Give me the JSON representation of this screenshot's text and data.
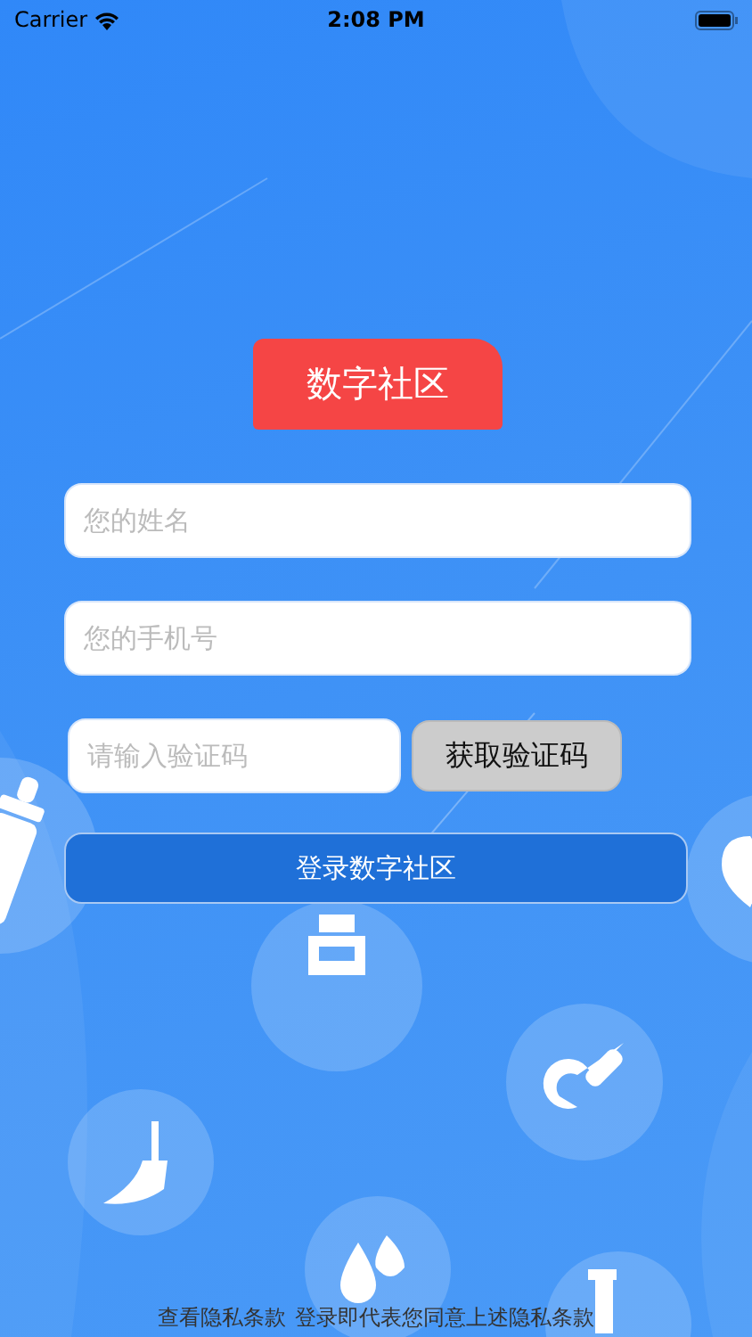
{
  "status_bar": {
    "carrier": "Carrier",
    "time": "2:08 PM"
  },
  "title": "数字社区",
  "fields": [
    {
      "placeholder": "您的姓名"
    },
    {
      "placeholder": "您的手机号"
    }
  ],
  "code_field": {
    "placeholder": "请输入验证码"
  },
  "get_code_button": "获取验证码",
  "login_button": "登录数字社区",
  "footer": {
    "link": "查看隐私条款",
    "notice": "登录即代表您同意上述隐私条款"
  }
}
